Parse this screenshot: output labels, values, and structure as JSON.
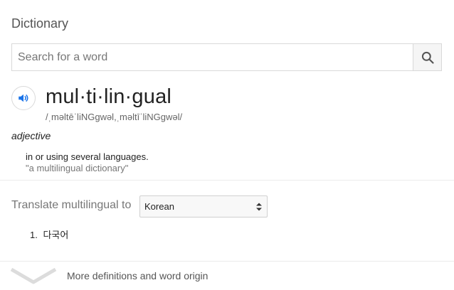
{
  "header": {
    "title": "Dictionary"
  },
  "search": {
    "placeholder": "Search for a word",
    "value": "",
    "button_icon": "search-icon"
  },
  "entry": {
    "speaker_icon": "speaker-icon",
    "headword": "mul·ti·lin·gual",
    "phonetic": "/ˌməltēˈliNGɡwəl,ˌməltīˈliNGɡwəl/",
    "part_of_speech": "adjective",
    "definitions": [
      {
        "text": "in or using several languages.",
        "example": "\"a multilingual dictionary\""
      }
    ]
  },
  "translate": {
    "label": "Translate multilingual to",
    "selected_language": "Korean",
    "results": [
      {
        "number": "1.",
        "text": "다국어"
      }
    ]
  },
  "footer": {
    "more_label": "More definitions and word origin",
    "chevron_icon": "chevron-down-icon"
  },
  "colors": {
    "accent_blue": "#1a73e8",
    "divider": "#ebebeb",
    "muted_text": "#777777"
  }
}
